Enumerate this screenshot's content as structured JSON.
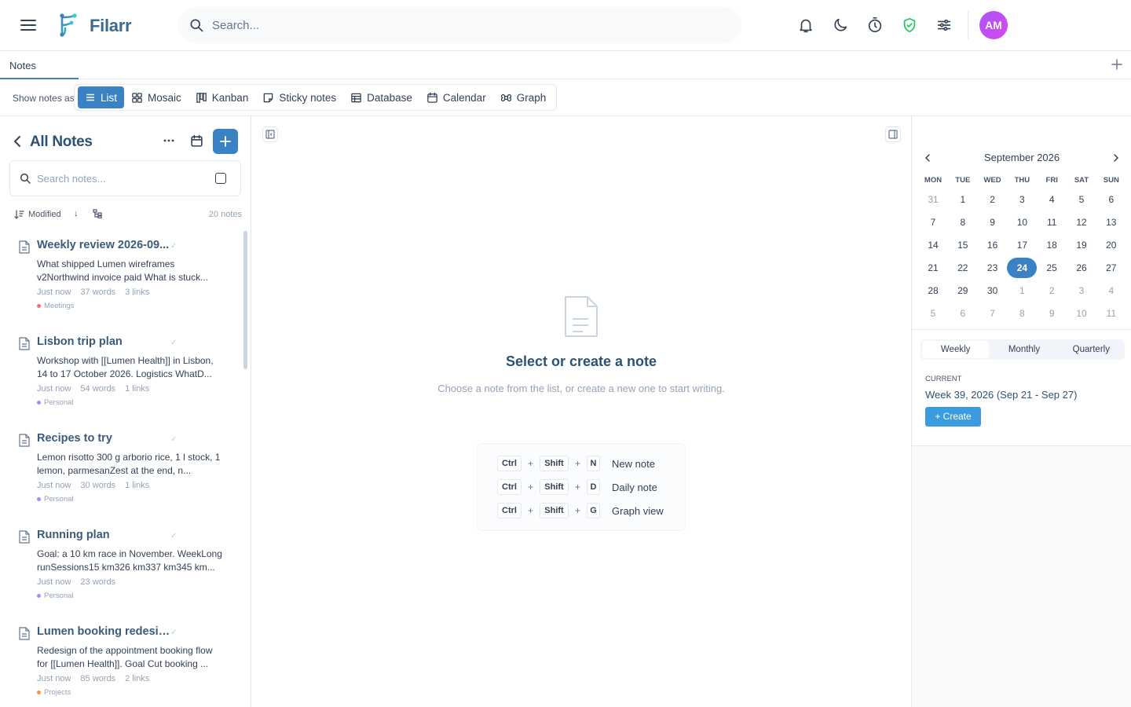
{
  "app": {
    "name": "Filarr",
    "avatar_initials": "AM",
    "accent_color": "#3b82c4",
    "search_placeholder": "Search..."
  },
  "tabs": [
    {
      "label": "Notes"
    }
  ],
  "viewbar": {
    "label": "Show notes as",
    "views": [
      {
        "label": "List",
        "icon": "list-icon",
        "active": true
      },
      {
        "label": "Mosaic",
        "icon": "mosaic-icon"
      },
      {
        "label": "Kanban",
        "icon": "kanban-icon"
      },
      {
        "label": "Sticky notes",
        "icon": "sticky-note-icon"
      },
      {
        "label": "Database",
        "icon": "database-icon"
      },
      {
        "label": "Calendar",
        "icon": "calendar-icon"
      },
      {
        "label": "Graph",
        "icon": "graph-icon"
      }
    ]
  },
  "notes_panel": {
    "title": "All Notes",
    "search_placeholder": "Search notes...",
    "sort_label": "Modified",
    "sort_dir": "↓",
    "count": "20 notes",
    "notes": [
      {
        "title": "Weekly review 2026-09...",
        "snippet": "What shipped Lumen wireframes v2Northwind invoice paid What is stuck...",
        "time": "Just now",
        "words": "37 words",
        "links": "3 links",
        "tag": "Meetings",
        "tag_color": "#f87171"
      },
      {
        "title": "Lisbon trip plan",
        "snippet": "Workshop with [[Lumen Health]] in Lisbon, 14 to 17 October 2026. Logistics WhatD...",
        "time": "Just now",
        "words": "54 words",
        "links": "1 links",
        "tag": "Personal",
        "tag_color": "#a78bfa"
      },
      {
        "title": "Recipes to try",
        "snippet": "Lemon risotto 300 g arborio rice, 1 l stock, 1 lemon, parmesanZest at the end, n...",
        "time": "Just now",
        "words": "30 words",
        "links": "1 links",
        "tag": "Personal",
        "tag_color": "#a78bfa"
      },
      {
        "title": "Running plan",
        "snippet": "Goal: a 10 km race in November. WeekLong runSessions15 km326 km337 km345 km...",
        "time": "Just now",
        "words": "23 words",
        "links": "",
        "tag": "Personal",
        "tag_color": "#a78bfa"
      },
      {
        "title": "Lumen booking redesign",
        "snippet": "Redesign of the appointment booking flow for [[Lumen Health]]. Goal Cut booking ...",
        "time": "Just now",
        "words": "85 words",
        "links": "2 links",
        "tag": "Projects",
        "tag_color": "#fb923c"
      }
    ]
  },
  "empty_state": {
    "title": "Select or create a note",
    "subtitle": "Choose a note from the list, or create a new one to start writing.",
    "shortcuts": [
      {
        "keys": [
          "Ctrl",
          "Shift",
          "N"
        ],
        "label": "New note"
      },
      {
        "keys": [
          "Ctrl",
          "Shift",
          "D"
        ],
        "label": "Daily note"
      },
      {
        "keys": [
          "Ctrl",
          "Shift",
          "G"
        ],
        "label": "Graph view"
      }
    ]
  },
  "calendar": {
    "month_label": "September 2026",
    "weekdays": [
      "MON",
      "TUE",
      "WED",
      "THU",
      "FRI",
      "SAT",
      "SUN"
    ],
    "weeks": [
      [
        "31",
        "1",
        "2",
        "3",
        "4",
        "5",
        "6"
      ],
      [
        "7",
        "8",
        "9",
        "10",
        "11",
        "12",
        "13"
      ],
      [
        "14",
        "15",
        "16",
        "17",
        "18",
        "19",
        "20"
      ],
      [
        "21",
        "22",
        "23",
        "24",
        "25",
        "26",
        "27"
      ],
      [
        "28",
        "29",
        "30",
        "1",
        "2",
        "3",
        "4"
      ],
      [
        "5",
        "6",
        "7",
        "8",
        "9",
        "10",
        "11"
      ]
    ],
    "today": "24",
    "period_tabs": [
      "Weekly",
      "Monthly",
      "Quarterly"
    ],
    "active_period": "Weekly",
    "current_label": "CURRENT",
    "current_period": "Week 39, 2026 (Sep 21 - Sep 27)",
    "create_label": "+ Create"
  }
}
